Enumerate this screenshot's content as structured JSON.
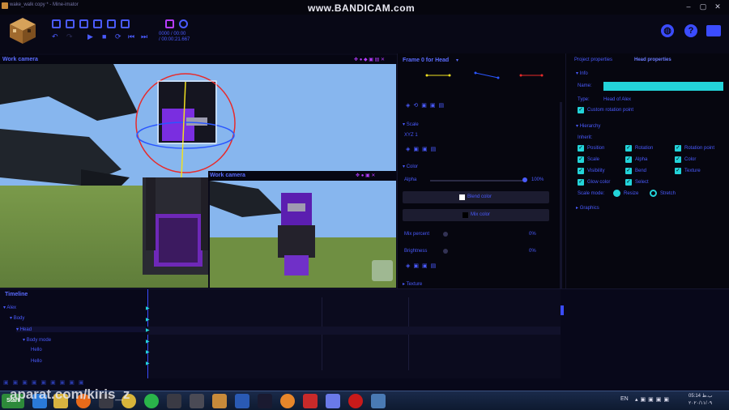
{
  "window": {
    "title": "wake_walk copy * - Mine-imator",
    "watermark": "www.BANDICAM.com",
    "controls": [
      "–",
      "▢",
      "✕"
    ]
  },
  "toolbar": {
    "timecode_frame": "0000 / 00:00",
    "timecode_total": "/ 00:00:21.667"
  },
  "viewport": {
    "title": "Work camera",
    "sub_title": "Work camera"
  },
  "mid_panel": {
    "title": "Frame 0 for Head",
    "scale_label": "Scale",
    "scale_value": "1",
    "color_section": "Color",
    "alpha_label": "Alpha",
    "alpha_value": "100%",
    "blend_color": "Blend color",
    "mix_color": "Mix color",
    "mix_percent_label": "Mix percent",
    "mix_percent_value": "0%",
    "brightness_label": "Brightness",
    "brightness_value": "0%",
    "texture_section": "Texture"
  },
  "right_panel": {
    "tab_project": "Project properties",
    "tab_head": "Head properties",
    "info_section": "Info",
    "name_label": "Name:",
    "name_value": "",
    "type_label": "Type:",
    "type_value": "Head of Alex",
    "custom_rotation": "Custom rotation point",
    "hierarchy_section": "Hierarchy",
    "inherit_label": "Inherit:",
    "inherit_options": [
      "Position",
      "Rotation",
      "Rotation point",
      "Scale",
      "Alpha",
      "Color",
      "Visibility",
      "Bend",
      "Texture",
      "Glow color",
      "Select"
    ],
    "scale_mode_label": "Scale mode:",
    "scale_mode_options": [
      "Resize",
      "Stretch"
    ],
    "graphics_section": "Graphics"
  },
  "timeline": {
    "title": "Timeline",
    "rows": [
      "Alex",
      "Body",
      "Head",
      "Body mode",
      "Hello",
      "Hello"
    ]
  },
  "taskbar": {
    "start": "Start",
    "lang": "EN",
    "time": "05:14 ب.ظ",
    "date": "۲۰۲۰/۱۱/۰۹",
    "overlay_watermark": "aparat.com/kiris_z"
  },
  "colors": {
    "accent": "#4a5bff",
    "cyan": "#23d4da",
    "bg": "#06060f"
  }
}
